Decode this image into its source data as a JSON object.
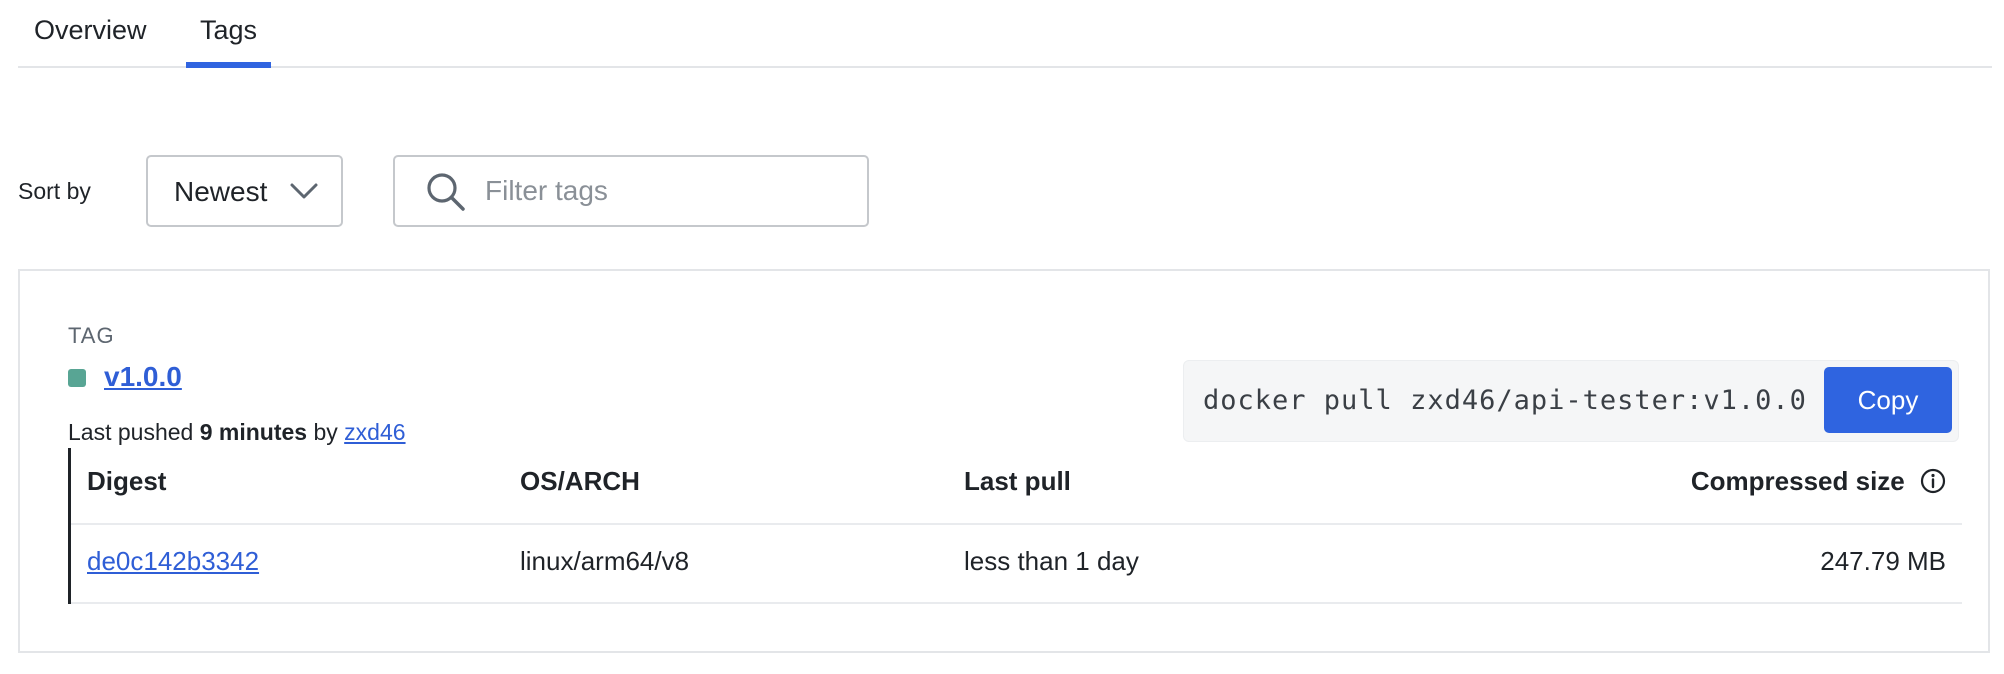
{
  "tabs": [
    {
      "label": "Overview",
      "active": false
    },
    {
      "label": "Tags",
      "active": true
    }
  ],
  "toolbar": {
    "sort_label": "Sort by",
    "sort_value": "Newest",
    "filter_placeholder": "Filter tags"
  },
  "tag_card": {
    "heading": "TAG",
    "tag_name": "v1.0.0",
    "status_color": "#58a594",
    "last_pushed_prefix": "Last pushed",
    "last_pushed_time": "9 minutes",
    "by_text": "by",
    "pushed_by": "zxd46",
    "pull_command": "docker pull zxd46/api-tester:v1.0.0",
    "copy_label": "Copy",
    "table": {
      "headers": [
        "Digest",
        "OS/ARCH",
        "Last pull",
        "Compressed size"
      ],
      "rows": [
        {
          "digest": "de0c142b3342",
          "os_arch": "linux/arm64/v8",
          "last_pull": "less than 1 day",
          "size": "247.79 MB"
        }
      ]
    }
  },
  "colors": {
    "accent": "#3064e0",
    "link": "#2f5ed6"
  },
  "icons": [
    "chevron-down-icon",
    "search-icon",
    "info-icon"
  ]
}
